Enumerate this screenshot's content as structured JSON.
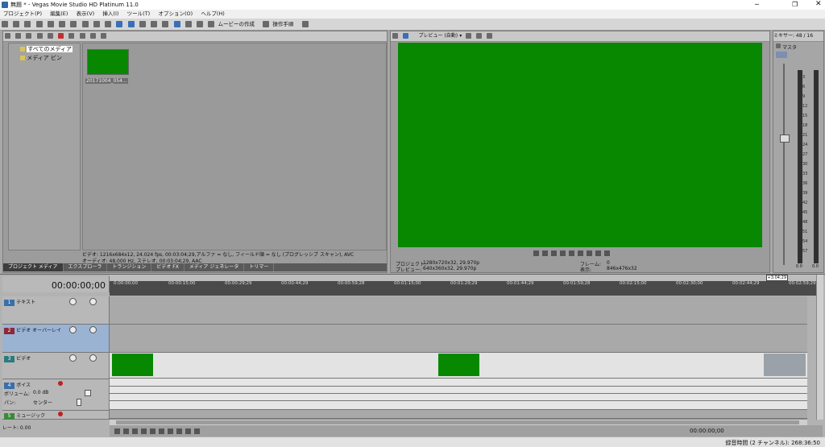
{
  "window": {
    "title": "無題 * - Vegas Movie Studio HD Platinum 11.0"
  },
  "menu": [
    "プロジェクト(P)",
    "編集(E)",
    "表示(V)",
    "挿入(I)",
    "ツール(T)",
    "オプション(O)",
    "ヘルプ(H)"
  ],
  "toolbar": {
    "make_movie": "ムービーの作成",
    "op_guide": "操作手順"
  },
  "media": {
    "tree": [
      "すべてのメディア",
      "メディア ビン"
    ],
    "clip_name": "20171004_054...",
    "info_video": "ビデオ: 1216x684x12, 24.024 fps, 00:03:04;29,アルファ = なし, フィールド順 = なし (プログレッシブ スキャン), AVC",
    "info_audio": "オーディオ: 48,000 Hz, ステレオ, 00:03:04;29, AAC",
    "tabs": [
      "プロジェクト メディア",
      "エクスプローラ",
      "トランジション",
      "ビデオ FX",
      "メディア ジェネレータ",
      "トリマー"
    ]
  },
  "preview": {
    "label": "プレビュー (自動)",
    "project_label": "プロジェクト:",
    "project_val": "1280x720x32, 29.970p",
    "preview_label": "プレビュー:",
    "preview_val": "640x360x32, 29.970p",
    "frame_label": "フレーム:",
    "frame_val": "0",
    "display_label": "表示:",
    "display_val": "846x476x32",
    "bg_color": "#088800"
  },
  "mixer": {
    "title": "ミキサー: 48 / 16",
    "master": "マスタ",
    "ticks": [
      "3",
      "6",
      "9",
      "12",
      "15",
      "18",
      "21",
      "24",
      "27",
      "30",
      "33",
      "36",
      "39",
      "42",
      "45",
      "48",
      "51",
      "54",
      "57"
    ],
    "left_val": "0.0",
    "right_val": "0.0"
  },
  "timeline": {
    "timecode": "00:00:00;00",
    "end_marker": "+3:04;29",
    "ruler": [
      "0:00:00;00",
      "00:00:15;00",
      "00:00:29;29",
      "00:00:44;29",
      "00:00:59;28",
      "00:01:15;00",
      "00:01:29;29",
      "00:01:44;29",
      "00:01:59;28",
      "00:02:15;00",
      "00:02:30;00",
      "00:02:44;29",
      "00:02:59;29"
    ],
    "tracks": [
      {
        "num": "1",
        "name": "テキスト"
      },
      {
        "num": "2",
        "name": "ビデオ オーバーレイ"
      },
      {
        "num": "3",
        "name": "ビデオ"
      },
      {
        "num": "4",
        "name": "ボイス"
      },
      {
        "num": "5",
        "name": "ミュージック"
      }
    ],
    "volume_label": "ボリューム:",
    "volume_val": "0.0 dB",
    "pan_label": "パン:",
    "pan_val": "センター",
    "rate_label": "レート: 0.00",
    "bottom_time": "00:00:00;00"
  },
  "status": {
    "text": "録音時間 (2 チャンネル): 268:36:50"
  }
}
